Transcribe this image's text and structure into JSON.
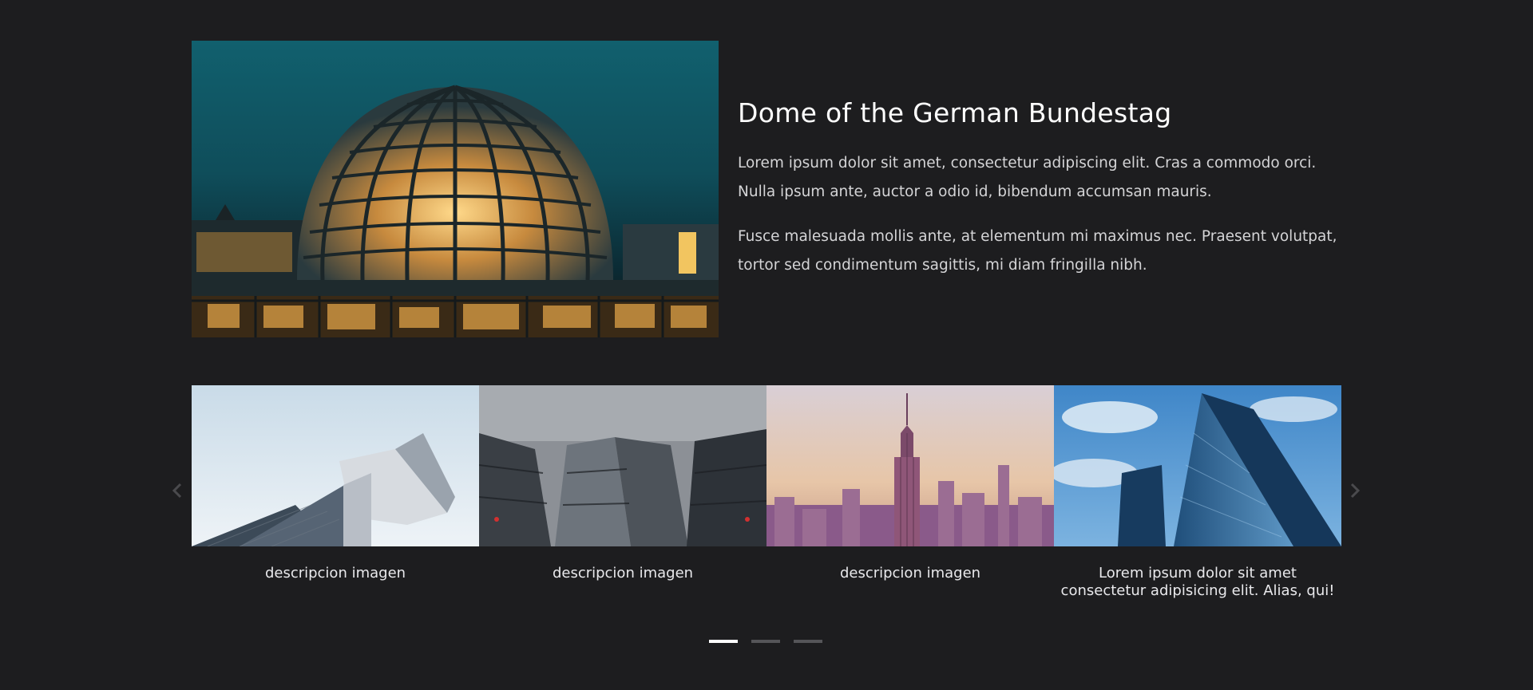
{
  "feature": {
    "title": "Dome of the German Bundestag",
    "paragraph_1": "Lorem ipsum dolor sit amet, consectetur adipiscing elit. Cras a commodo orci. Nulla ipsum ante, auctor a odio id, bibendum accumsan mauris.",
    "paragraph_2": "Fusce malesuada mollis ante, at elementum mi maximus nec. Praesent volutpat, tortor sed condimentum sagittis, mi diam fringilla nibh."
  },
  "carousel": {
    "prev_icon": "chevron-left-icon",
    "next_icon": "chevron-right-icon",
    "slides": [
      {
        "caption": "descripcion imagen"
      },
      {
        "caption": "descripcion imagen"
      },
      {
        "caption": "descripcion imagen"
      },
      {
        "caption": "Lorem ipsum dolor sit amet consectetur adipisicing elit. Alias, qui!"
      }
    ],
    "active_page": 1,
    "page_count": 3
  },
  "colors": {
    "background": "#1d1d1f",
    "title": "#ffffff",
    "body_text": "#d4d4d6",
    "dot_active": "#ffffff",
    "dot_inactive": "#555558"
  }
}
